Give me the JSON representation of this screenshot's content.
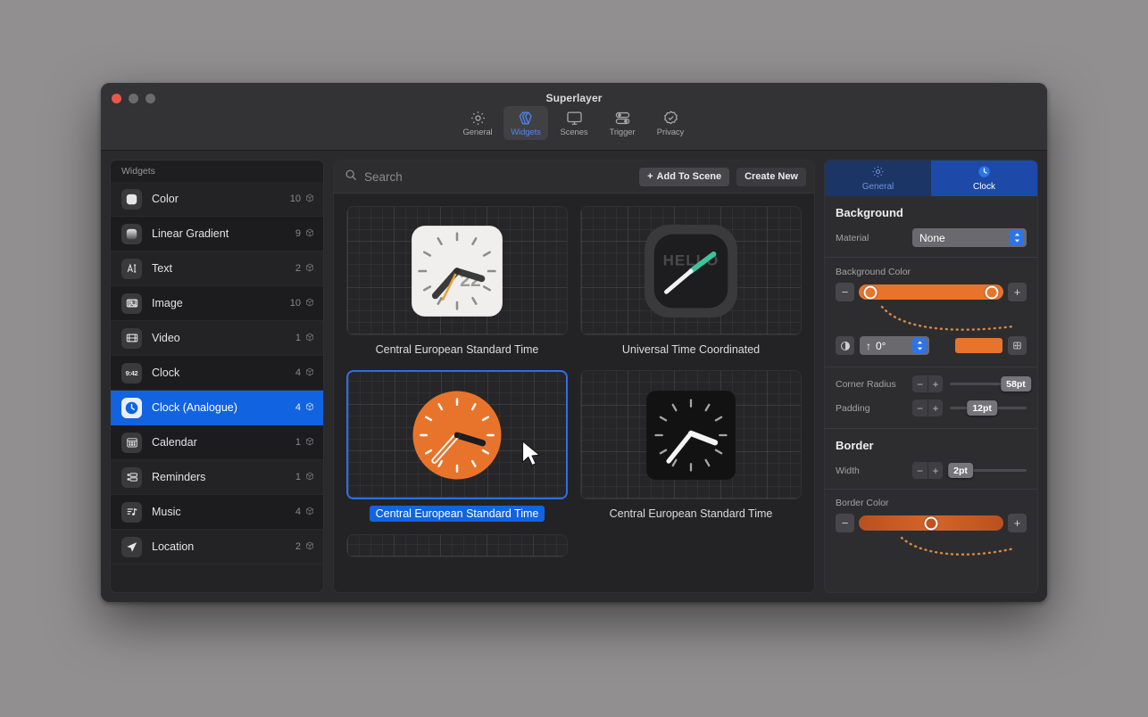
{
  "window": {
    "title": "Superlayer",
    "traffic_lights": [
      "close",
      "minimize",
      "zoom"
    ]
  },
  "toolbar": {
    "tabs": [
      {
        "label": "General",
        "icon": "gear-icon",
        "active": false
      },
      {
        "label": "Widgets",
        "icon": "layers-icon",
        "active": true
      },
      {
        "label": "Scenes",
        "icon": "display-icon",
        "active": false
      },
      {
        "label": "Trigger",
        "icon": "toggles-icon",
        "active": false
      },
      {
        "label": "Privacy",
        "icon": "badge-check-icon",
        "active": false
      }
    ]
  },
  "sidebar": {
    "header": "Widgets",
    "items": [
      {
        "label": "Color",
        "count": "10",
        "icon": "color-swatch-icon",
        "selected": false
      },
      {
        "label": "Linear Gradient",
        "count": "9",
        "icon": "gradient-icon",
        "selected": false
      },
      {
        "label": "Text",
        "count": "2",
        "icon": "text-cursor-icon",
        "selected": false
      },
      {
        "label": "Image",
        "count": "10",
        "icon": "image-icon",
        "selected": false
      },
      {
        "label": "Video",
        "count": "1",
        "icon": "film-icon",
        "selected": false
      },
      {
        "label": "Clock",
        "count": "4",
        "icon": "digital-clock-icon",
        "selected": false
      },
      {
        "label": "Clock (Analogue)",
        "count": "4",
        "icon": "analogue-clock-icon",
        "selected": true
      },
      {
        "label": "Calendar",
        "count": "1",
        "icon": "calendar-icon",
        "selected": false
      },
      {
        "label": "Reminders",
        "count": "1",
        "icon": "reminders-icon",
        "selected": false
      },
      {
        "label": "Music",
        "count": "4",
        "icon": "music-note-icon",
        "selected": false
      },
      {
        "label": "Location",
        "count": "2",
        "icon": "location-arrow-icon",
        "selected": false
      }
    ]
  },
  "search": {
    "value": "",
    "placeholder": "Search",
    "icon": "search-icon"
  },
  "actions": {
    "add_to_scene": "Add To Scene",
    "add_to_scene_prefix": "+",
    "create_new": "Create New"
  },
  "gallery": {
    "cards": [
      {
        "caption": "Central European Standard Time",
        "style": "white-square-clock",
        "face_text": "22",
        "selected": false
      },
      {
        "caption": "Universal Time Coordinated",
        "style": "dark-rounded-clock",
        "face_text": "HELLO",
        "selected": false
      },
      {
        "caption": "Central European Standard Time",
        "style": "orange-circle-clock",
        "face_text": "",
        "selected": true
      },
      {
        "caption": "Central European Standard Time",
        "style": "black-square-clock",
        "face_text": "",
        "selected": false
      }
    ],
    "cursor": "arrow-pointer"
  },
  "inspector": {
    "tabs": [
      {
        "label": "General",
        "icon": "gear-icon",
        "active": false
      },
      {
        "label": "Clock",
        "icon": "clock-icon",
        "active": true
      }
    ],
    "background": {
      "title": "Background",
      "material_label": "Material",
      "material_value": "None",
      "color_label": "Background Color",
      "gradient_color": "#e8742c",
      "stops": [
        8,
        92
      ],
      "angle_value": "0°",
      "angle_direction": "↑",
      "swatch_color": "#e8742c"
    },
    "metrics": [
      {
        "label": "Corner Radius",
        "value": "58pt",
        "position": 86
      },
      {
        "label": "Padding",
        "value": "12pt",
        "position": 42
      }
    ],
    "border": {
      "title": "Border",
      "width_label": "Width",
      "width_value": "2pt",
      "width_position": 14,
      "color_label": "Border Color",
      "color": "#c0521e",
      "stop": 50
    }
  },
  "colors": {
    "accent_blue": "#1263e0",
    "orange": "#e8742c",
    "border_orange": "#c0521e",
    "window_bg": "#2a2a2c",
    "panel_bg": "#232325"
  }
}
